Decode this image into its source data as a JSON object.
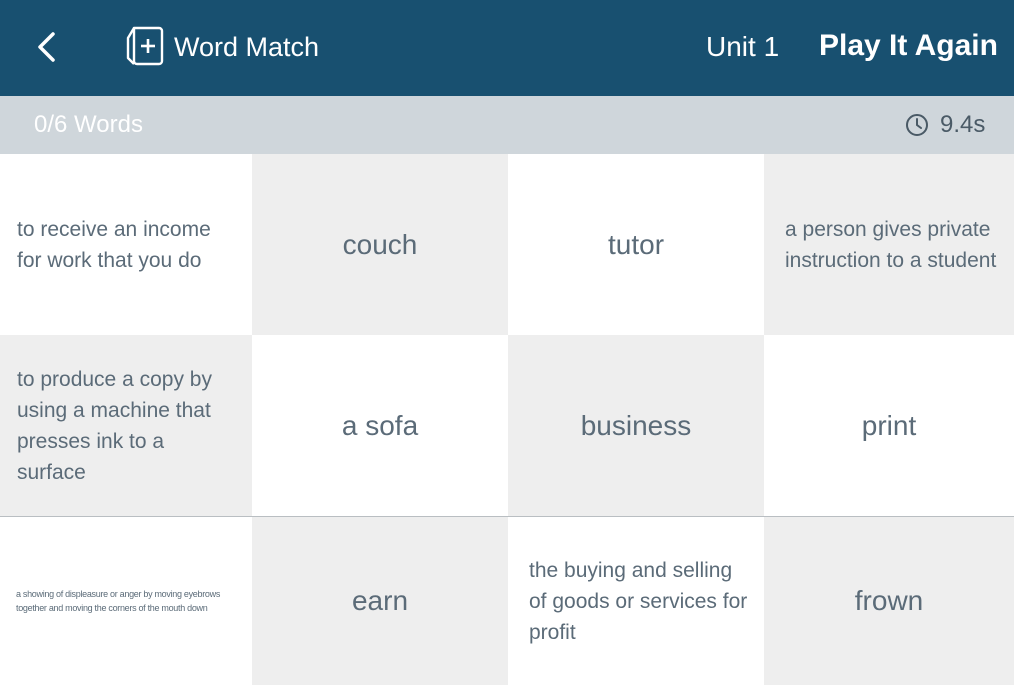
{
  "header": {
    "title": "Word Match",
    "unit": "Unit 1",
    "replay_label": "Play It Again",
    "back_icon": "chevron-left-icon",
    "app_icon": "add-card-icon"
  },
  "status": {
    "word_count": "0/6 Words",
    "timer": "9.4s",
    "timer_icon": "clock-icon"
  },
  "cards": [
    {
      "text": "to receive an income for work that you do",
      "kind": "definition"
    },
    {
      "text": "couch",
      "kind": "word"
    },
    {
      "text": "tutor",
      "kind": "word"
    },
    {
      "text": "a person gives private instruction to a student",
      "kind": "definition"
    },
    {
      "text": "to produce a copy by using a machine that presses ink to a surface",
      "kind": "definition"
    },
    {
      "text": "a sofa",
      "kind": "word"
    },
    {
      "text": "business",
      "kind": "word"
    },
    {
      "text": "print",
      "kind": "word"
    },
    {
      "text": "a showing of displeasure or anger by moving eyebrows together and moving the corners of the mouth down",
      "kind": "definition"
    },
    {
      "text": "earn",
      "kind": "word"
    },
    {
      "text": "the buying and selling of goods or services for profit",
      "kind": "definition"
    },
    {
      "text": "frown",
      "kind": "word"
    }
  ],
  "colors": {
    "header_bg": "#185070",
    "status_bg": "#cfd6db",
    "card_gray": "#eeeeee",
    "card_light": "#ffffff",
    "text": "#5b6b78"
  }
}
